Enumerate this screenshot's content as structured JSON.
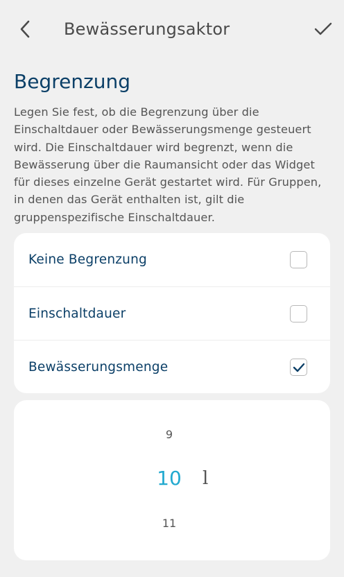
{
  "header": {
    "title": "Bewässerungsaktor",
    "back_icon": "chevron-left-icon",
    "confirm_icon": "checkmark-icon"
  },
  "section": {
    "title": "Begrenzung",
    "description": "Legen Sie fest, ob die Begrenzung über die Einschaltdauer oder Bewässerungsmenge gesteuert wird. Die Einschaltdauer wird begrenzt, wenn die Bewässerung über die Raumansicht oder das Widget für dieses einzelne Gerät gestartet wird. Für Gruppen, in denen das Gerät enthalten ist, gilt die gruppenspezifische Einschaltdauer."
  },
  "options": [
    {
      "label": "Keine Begrenzung",
      "checked": false
    },
    {
      "label": "Einschaltdauer",
      "checked": false
    },
    {
      "label": "Bewässerungsmenge",
      "checked": true
    }
  ],
  "picker": {
    "previous": "9",
    "current": "10",
    "next": "11",
    "unit": "l"
  },
  "colors": {
    "accent": "#22a9cf",
    "primary_text": "#0b3f67",
    "background": "#f0f0f0"
  }
}
